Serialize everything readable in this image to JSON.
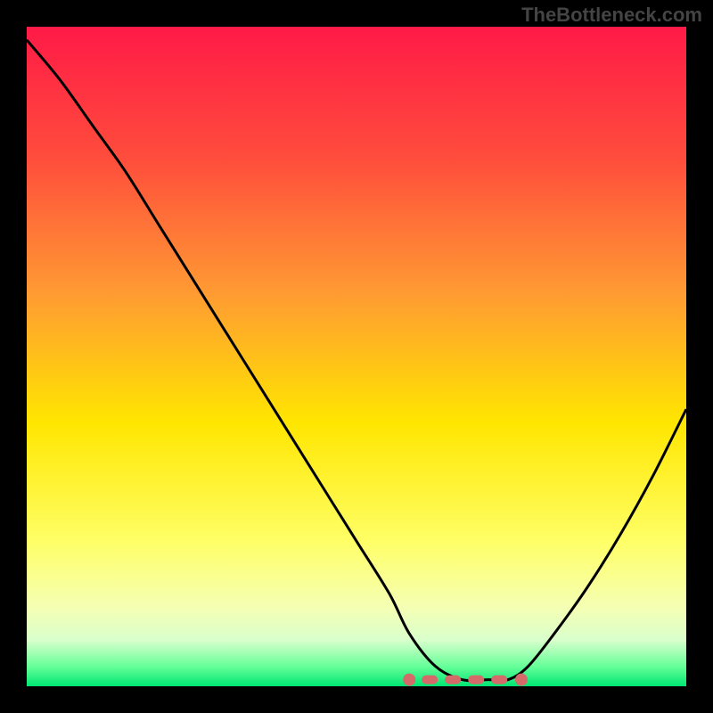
{
  "watermark": "TheBottleneck.com",
  "chart_data": {
    "type": "line",
    "title": "",
    "xlabel": "",
    "ylabel": "",
    "xlim": [
      0,
      100
    ],
    "ylim": [
      0,
      100
    ],
    "series": [
      {
        "name": "curve",
        "x": [
          0,
          5,
          10,
          15,
          20,
          25,
          30,
          35,
          40,
          45,
          50,
          55,
          58,
          62,
          66,
          70,
          73,
          76,
          80,
          85,
          90,
          95,
          100
        ],
        "values": [
          98,
          92,
          85,
          78,
          70,
          62,
          54,
          46,
          38,
          30,
          22,
          14,
          8,
          3,
          1,
          1,
          1,
          3,
          8,
          15,
          23,
          32,
          42
        ]
      }
    ],
    "highlight_region": {
      "x_start": 58,
      "x_end": 75,
      "y": 1
    },
    "background_gradient": {
      "type": "vertical",
      "stops": [
        {
          "pos": 0.0,
          "color": "#ff1a47"
        },
        {
          "pos": 0.2,
          "color": "#ff4d3c"
        },
        {
          "pos": 0.4,
          "color": "#ff9933"
        },
        {
          "pos": 0.6,
          "color": "#ffe600"
        },
        {
          "pos": 0.78,
          "color": "#ffff66"
        },
        {
          "pos": 0.88,
          "color": "#f5ffb3"
        },
        {
          "pos": 0.93,
          "color": "#d9ffcc"
        },
        {
          "pos": 0.97,
          "color": "#66ff99"
        },
        {
          "pos": 1.0,
          "color": "#00e673"
        }
      ]
    },
    "curve_color": "#000000",
    "highlight_color": "#d46a6a"
  }
}
